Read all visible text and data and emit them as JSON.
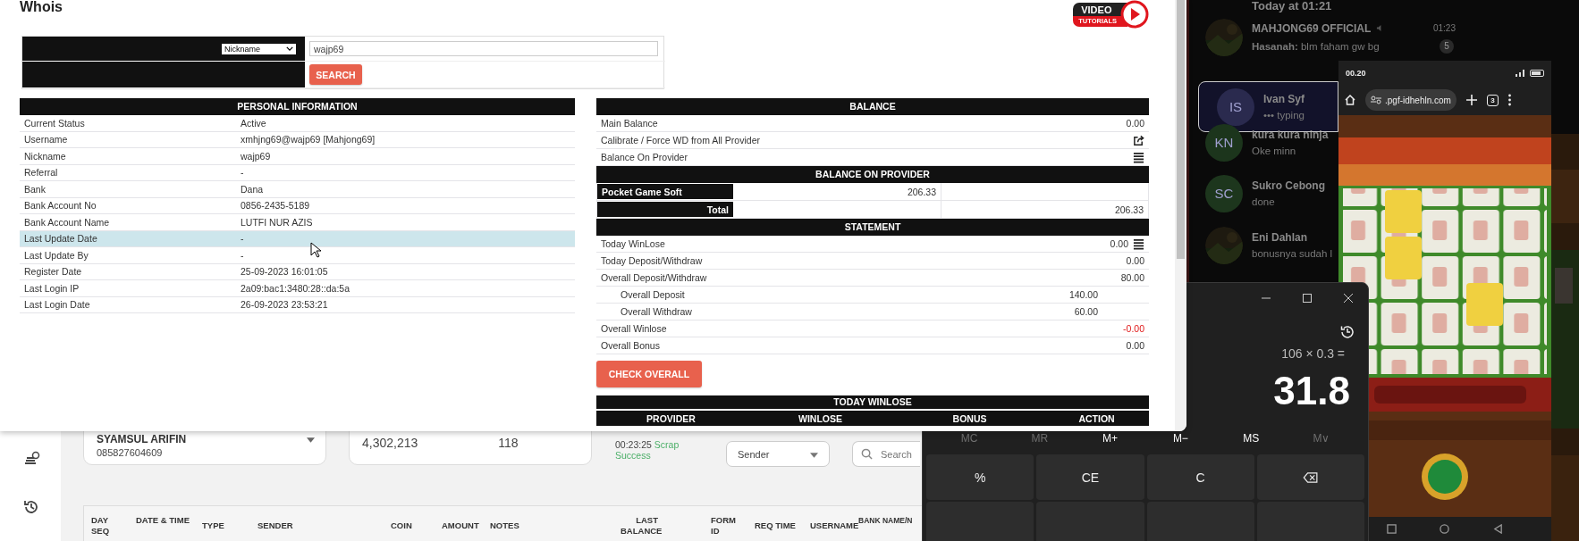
{
  "background_app": {
    "customer": {
      "name": "SYAMSUL ARIFIN",
      "phone": "085827604609"
    },
    "stats": [
      {
        "value": "4,302,213"
      },
      {
        "value": "118"
      }
    ],
    "status": {
      "time": "00:23:25",
      "state": "Scrap Success"
    },
    "search_by": {
      "value": "Sender"
    },
    "search": {
      "placeholder": "Search"
    },
    "table": {
      "columns": [
        "DAY SEQ",
        "DATE & TIME",
        "TYPE",
        "SENDER",
        "COIN",
        "AMOUNT",
        "NOTES",
        "LAST BALANCE",
        "FORM ID",
        "REQ TIME",
        "USERNAME",
        "BANK NAME/N"
      ]
    }
  },
  "whois": {
    "title": "Whois",
    "tutorial": {
      "top": "VIDEO",
      "bottom": "TUTORIALS"
    },
    "search": {
      "field": "Nickname",
      "value": "wajp69",
      "button": "SEARCH"
    },
    "personal": {
      "heading": "PERSONAL INFORMATION",
      "rows": [
        {
          "label": "Current Status",
          "value": "Active",
          "selected": false
        },
        {
          "label": "Username",
          "value": "xmhjng69@wajp69  [Mahjong69]",
          "selected": false
        },
        {
          "label": "Nickname",
          "value": "wajp69",
          "selected": false
        },
        {
          "label": "Referral",
          "value": "-",
          "selected": false
        },
        {
          "label": "Bank",
          "value": "Dana",
          "selected": false
        },
        {
          "label": "Bank Account No",
          "value": "0856-2435-5189",
          "selected": false
        },
        {
          "label": "Bank Account Name",
          "value": "LUTFI NUR AZIS",
          "selected": false
        },
        {
          "label": "Last Update Date",
          "value": "-",
          "selected": true
        },
        {
          "label": "Last Update By",
          "value": "-",
          "selected": false
        },
        {
          "label": "Register Date",
          "value": "25-09-2023 16:01:05",
          "selected": false
        },
        {
          "label": "Last Login IP",
          "value": "2a09:bac1:3480:28::da:5a",
          "selected": false
        },
        {
          "label": "Last Login Date",
          "value": "26-09-2023 23:53:21",
          "selected": false
        }
      ]
    },
    "balance": {
      "heading": "BALANCE",
      "rows": [
        {
          "label": "Main Balance",
          "kind": "value",
          "value": "0.00"
        },
        {
          "label": "Calibrate / Force WD from All Provider",
          "kind": "share"
        },
        {
          "label": "Balance On Provider",
          "kind": "list"
        }
      ]
    },
    "balance_on_provider": {
      "heading": "BALANCE ON PROVIDER",
      "providers": [
        {
          "name": "Pocket Game Soft",
          "amount": "206.33"
        }
      ],
      "total": {
        "label": "Total",
        "amount": "206.33"
      }
    },
    "statement": {
      "heading": "STATEMENT",
      "rows": [
        {
          "label": "Today WinLose",
          "value": "0.00",
          "kind": "list",
          "negative": false
        },
        {
          "label": "Today Deposit/Withdraw",
          "value": "0.00",
          "kind": "plain",
          "negative": false
        },
        {
          "label": "Overall Deposit/Withdraw",
          "value": "80.00",
          "kind": "plain",
          "negative": false,
          "children": [
            {
              "label": "Overall Deposit",
              "value": "140.00",
              "negative": false
            },
            {
              "label": "Overall Withdraw",
              "value": "60.00",
              "negative": false
            }
          ]
        },
        {
          "label": "Overall Winlose",
          "value": "-0.00",
          "kind": "plain",
          "negative": true
        },
        {
          "label": "Overall Bonus",
          "value": "0.00",
          "kind": "plain",
          "negative": false
        }
      ]
    },
    "check_button": "CHECK OVERALL",
    "today_winlose": {
      "heading": "TODAY WINLOSE",
      "columns": [
        "PROVIDER",
        "WINLOSE",
        "BONUS",
        "ACTION"
      ]
    }
  },
  "calculator": {
    "expression": "106 × 0.3 =",
    "result": "31.8",
    "memory": [
      {
        "label": "MC",
        "disabled": true
      },
      {
        "label": "MR",
        "disabled": true
      },
      {
        "label": "M+",
        "disabled": false
      },
      {
        "label": "M−",
        "disabled": false
      },
      {
        "label": "MS",
        "disabled": false
      },
      {
        "label": "M∨",
        "disabled": true
      }
    ],
    "keys": [
      {
        "kind": "text",
        "label": "%"
      },
      {
        "kind": "text",
        "label": "CE"
      },
      {
        "kind": "text",
        "label": "C"
      },
      {
        "kind": "backspace"
      }
    ]
  },
  "chat": {
    "header_time": "Today at 01:21",
    "conversations": [
      {
        "name": "MAHJONG69 OFFICIAL",
        "message": "**Hasanah:** blm faham gw bg",
        "time": "01:23",
        "unread": "5",
        "muted": true,
        "selected": false
      },
      {
        "name": "Ivan Syf",
        "message": "••• typing",
        "muted": false,
        "selected": true,
        "avatar": {
          "kind": "initials",
          "initials": "IS",
          "color": "#2a2a4e"
        }
      },
      {
        "name": "kura kura ninja",
        "message": "Oke minn",
        "muted": false,
        "selected": false,
        "avatar": {
          "kind": "initials",
          "initials": "KN",
          "color": "#1c351c"
        }
      },
      {
        "name": "Sukro Cebong",
        "message": "done",
        "muted": false,
        "selected": false,
        "avatar": {
          "kind": "initials",
          "initials": "SC",
          "color": "#1d361d"
        }
      },
      {
        "name": "Eni Dahlan",
        "message": "bonusnya sudah l",
        "muted": false,
        "selected": false
      }
    ]
  },
  "phone": {
    "time": "00.20",
    "url": ".pgf-idhehln.com",
    "tab_count": "3"
  }
}
